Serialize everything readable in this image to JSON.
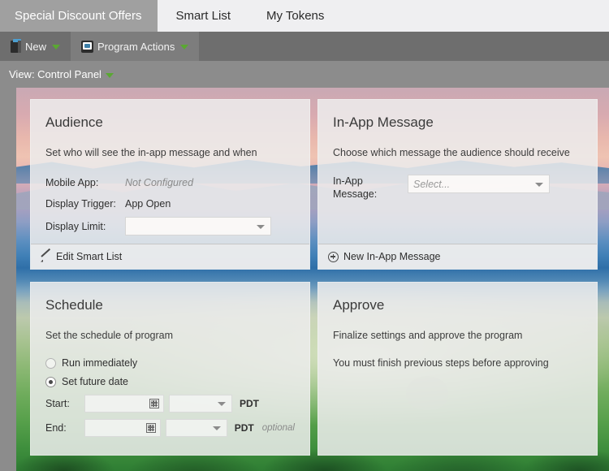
{
  "tabs": [
    {
      "label": "Special Discount Offers",
      "active": true
    },
    {
      "label": "Smart List",
      "active": false
    },
    {
      "label": "My Tokens",
      "active": false
    }
  ],
  "toolbar": {
    "new_label": "New",
    "program_actions_label": "Program Actions"
  },
  "viewbar": {
    "label": "View: Control Panel"
  },
  "panels": {
    "audience": {
      "title": "Audience",
      "description": "Set who will see the in-app message and when",
      "fields": {
        "mobile_app_label": "Mobile App:",
        "mobile_app_value": "Not Configured",
        "display_trigger_label": "Display Trigger:",
        "display_trigger_value": "App Open",
        "display_limit_label": "Display Limit:",
        "display_limit_value": ""
      },
      "footer_action": "Edit Smart List"
    },
    "message": {
      "title": "In-App Message",
      "description": "Choose which message the audience should receive",
      "fields": {
        "in_app_message_label": "In-App Message:",
        "in_app_message_placeholder": "Select..."
      },
      "footer_action": "New In-App Message"
    },
    "schedule": {
      "title": "Schedule",
      "description": "Set the schedule of program",
      "options": [
        {
          "label": "Run immediately",
          "selected": false
        },
        {
          "label": "Set future date",
          "selected": true
        }
      ],
      "start_label": "Start:",
      "start_date_value": "",
      "start_time_value": "",
      "start_timezone": "PDT",
      "end_label": "End:",
      "end_date_value": "",
      "end_time_value": "",
      "end_timezone": "PDT",
      "end_optional_note": "optional"
    },
    "approve": {
      "title": "Approve",
      "description": "Finalize settings and approve the program",
      "note": "You must finish previous steps before approving"
    }
  },
  "colors": {
    "active_tab_bg": "#a0a0a0",
    "tabbar_bg": "#efeff1",
    "toolbar_bg": "#6e6e6e",
    "viewbar_bg": "#8c8c8c",
    "panel_bg": "#ececec",
    "caret_green": "#5aa832",
    "text_dark": "#2f2f2f",
    "text_muted": "#8a8a8a"
  }
}
